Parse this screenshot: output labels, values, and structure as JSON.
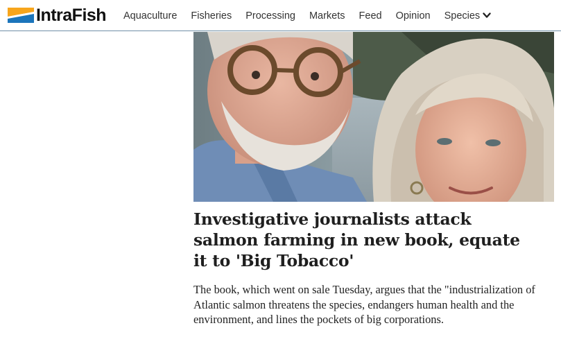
{
  "brand": {
    "name": "IntraFish",
    "colors": {
      "stripe_top": "#f7a51c",
      "stripe_mid": "#ffffff",
      "stripe_bottom": "#1b75bb"
    }
  },
  "nav": {
    "items": [
      {
        "label": "Aquaculture"
      },
      {
        "label": "Fisheries"
      },
      {
        "label": "Processing"
      },
      {
        "label": "Markets"
      },
      {
        "label": "Feed"
      },
      {
        "label": "Opinion"
      },
      {
        "label": "Species",
        "icon": "chevron-down-icon"
      }
    ]
  },
  "article": {
    "image_icon": "photo-two-people",
    "headline": "Investigative journalists attack salmon farming in new book, equate it to 'Big Tobacco'",
    "lede": "The book, which went on sale Tuesday, argues that the \"industrialization of Atlantic salmon threatens the species, endangers human health and the environment, and lines the pockets of big corporations."
  }
}
